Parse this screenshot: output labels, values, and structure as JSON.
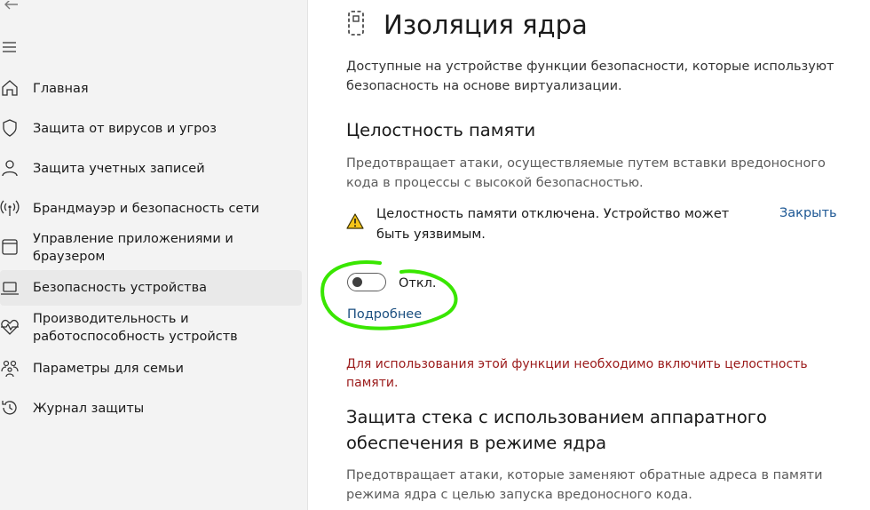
{
  "sidebar": {
    "items": [
      {
        "label": "Главная",
        "icon": "home-icon"
      },
      {
        "label": "Защита от вирусов и угроз",
        "icon": "shield-icon"
      },
      {
        "label": "Защита учетных записей",
        "icon": "person-icon"
      },
      {
        "label": "Брандмауэр и безопасность сети",
        "icon": "antenna-icon"
      },
      {
        "label": "Управление приложениями и\nбраузером",
        "icon": "app-browser-icon"
      },
      {
        "label": "Безопасность устройства",
        "icon": "laptop-icon",
        "selected": true
      },
      {
        "label": "Производительность и\nработоспособность устройств",
        "icon": "heart-pulse-icon"
      },
      {
        "label": "Параметры для семьи",
        "icon": "family-icon"
      },
      {
        "label": "Журнал защиты",
        "icon": "history-icon"
      }
    ]
  },
  "main": {
    "title": "Изоляция ядра",
    "description": "Доступные на устройстве функции безопасности, которые используют безопасность на основе виртуализации.",
    "memory_integrity": {
      "title": "Целостность памяти",
      "description": "Предотвращает атаки, осуществляемые путем вставки вредоносного кода в процессы с высокой безопасностью.",
      "warning": "Целостность памяти отключена. Устройство может быть уязвимым.",
      "close_label": "Закрыть",
      "toggle_state": "Откл.",
      "learn_more": "Подробнее",
      "requirement_notice": "Для использования этой функции необходимо включить целостность памяти."
    },
    "stack_protection": {
      "title": "Защита стека с использованием аппаратного обеспечения в режиме ядра",
      "description": "Предотвращает атаки, которые заменяют обратные адреса в памяти режима ядра с целью запуска вредоносного кода."
    }
  },
  "colors": {
    "sidebar_bg": "#f3f3f3",
    "link": "#1b5693",
    "error": "#9b1a1a",
    "warning": "#f5c518",
    "annotation": "#39e600"
  }
}
